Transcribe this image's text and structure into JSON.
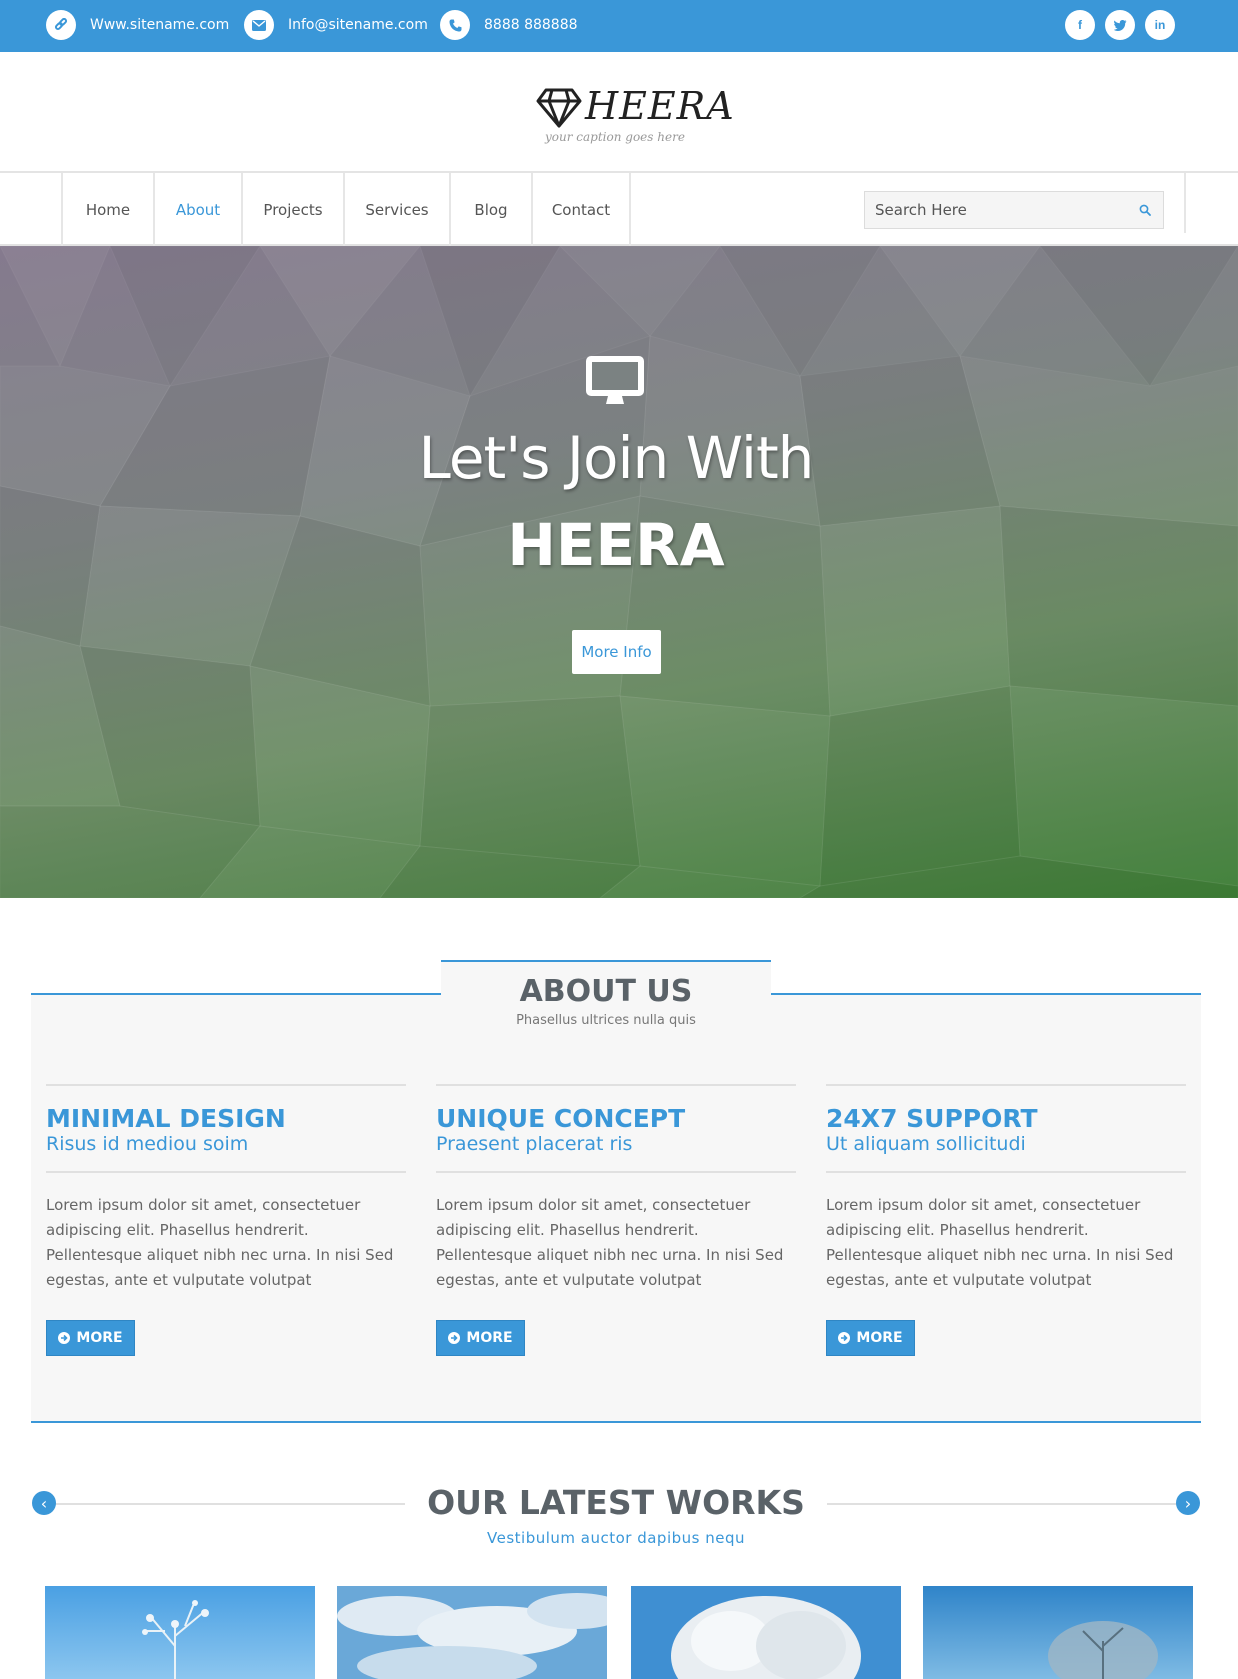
{
  "topbar": {
    "website": "Www.sitename.com",
    "email": "Info@sitename.com",
    "phone": "8888 888888",
    "social": [
      "f",
      "t",
      "in"
    ]
  },
  "logo": {
    "name": "HEERA",
    "caption": "your caption goes here"
  },
  "nav": {
    "items": [
      "Home",
      "About",
      "Projects",
      "Services",
      "Blog",
      "Contact"
    ],
    "active": "About",
    "search_placeholder": "Search Here"
  },
  "hero": {
    "title": "Let's Join With",
    "brand": "HEERA",
    "button": "More Info"
  },
  "about": {
    "title": "ABOUT US",
    "subtitle": "Phasellus ultrices nulla quis",
    "features": [
      {
        "title": "MINIMAL DESIGN",
        "subtitle": "Risus id mediou soim",
        "body": "Lorem ipsum dolor sit amet, consectetuer adipiscing elit. Phasellus hendrerit. Pellentesque aliquet nibh nec urna. In nisi Sed egestas, ante et vulputate volutpat",
        "button": "MORE"
      },
      {
        "title": "UNIQUE CONCEPT",
        "subtitle": "Praesent placerat ris",
        "body": "Lorem ipsum dolor sit amet, consectetuer adipiscing elit. Phasellus hendrerit. Pellentesque aliquet nibh nec urna. In nisi Sed egestas, ante et vulputate volutpat",
        "button": "MORE"
      },
      {
        "title": "24X7 SUPPORT",
        "subtitle": "Ut aliquam sollicitudi",
        "body": "Lorem ipsum dolor sit amet, consectetuer adipiscing elit. Phasellus hendrerit. Pellentesque aliquet nibh nec urna. In nisi Sed egestas, ante et vulputate volutpat",
        "button": "MORE"
      }
    ]
  },
  "works": {
    "title": "OUR LATEST WORKS",
    "subtitle": "Vestibulum auctor dapibus nequ",
    "prev": "‹",
    "next": "›"
  },
  "colors": {
    "accent": "#3a97d8",
    "heading": "#5a6268"
  }
}
